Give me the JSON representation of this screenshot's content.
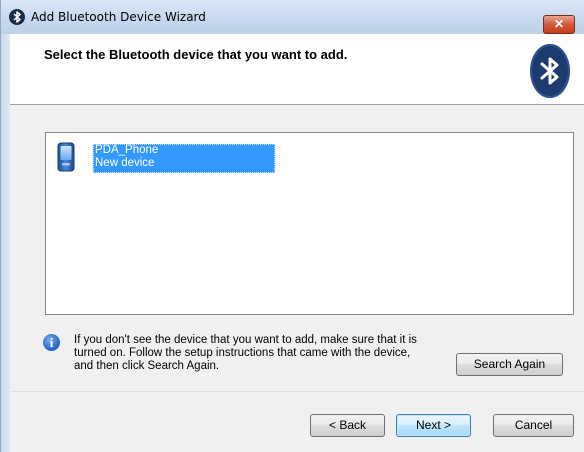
{
  "window": {
    "title": "Add Bluetooth Device Wizard",
    "close_label": "✕"
  },
  "header": {
    "title": "Select the Bluetooth device that you want to add.",
    "logo_icon": "bluetooth-icon"
  },
  "devices": [
    {
      "name": "PDA_Phone",
      "status": "New device",
      "icon": "pda-phone-icon",
      "selected": true
    }
  ],
  "info": {
    "icon": "info-icon",
    "text_line1": "If you don't see the device that you want to add, make sure that it is",
    "text_line2": "turned on. Follow the setup instructions that came with the device,",
    "text_line3": "and then click Search Again."
  },
  "buttons": {
    "search_again": "Search Again",
    "back": "< Back",
    "next": "Next >",
    "cancel": "Cancel"
  },
  "colors": {
    "selection": "#3399ff",
    "bluetooth_blue": "#1d3b6e"
  }
}
